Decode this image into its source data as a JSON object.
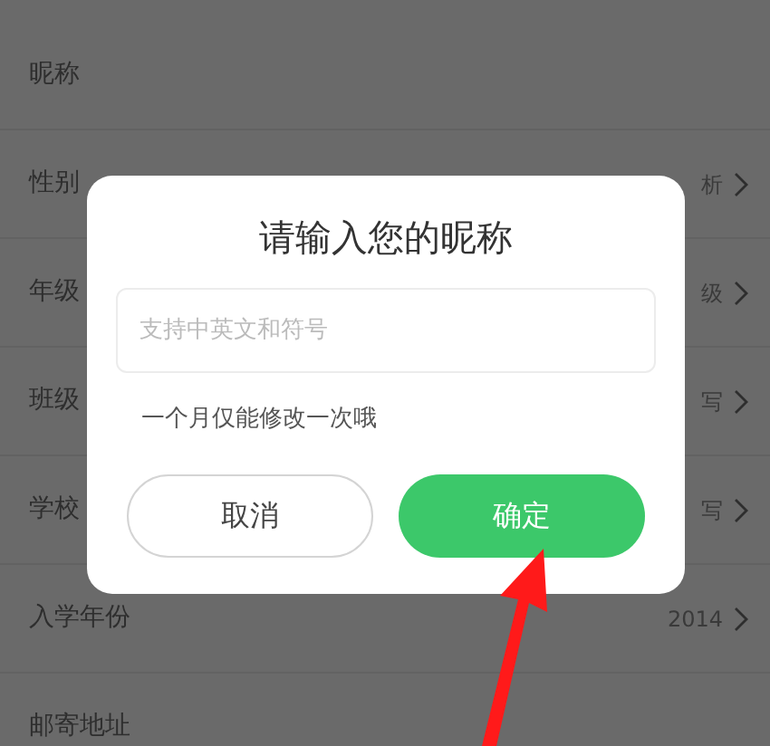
{
  "rows": [
    {
      "label": "昵称"
    },
    {
      "label": "性别",
      "value": "析"
    },
    {
      "label": "年级",
      "value": "级"
    },
    {
      "label": "班级",
      "value": "写"
    },
    {
      "label": "学校",
      "value": "写"
    },
    {
      "label": "入学年份",
      "value": "2014"
    },
    {
      "label": "邮寄地址"
    }
  ],
  "dialog": {
    "title": "请输入您的昵称",
    "input": {
      "placeholder": "支持中英文和符号"
    },
    "hint": "一个月仅能修改一次哦",
    "buttons": [
      {
        "label": "取消",
        "kind": "secondary"
      },
      {
        "label": "确定",
        "kind": "primary"
      }
    ]
  }
}
